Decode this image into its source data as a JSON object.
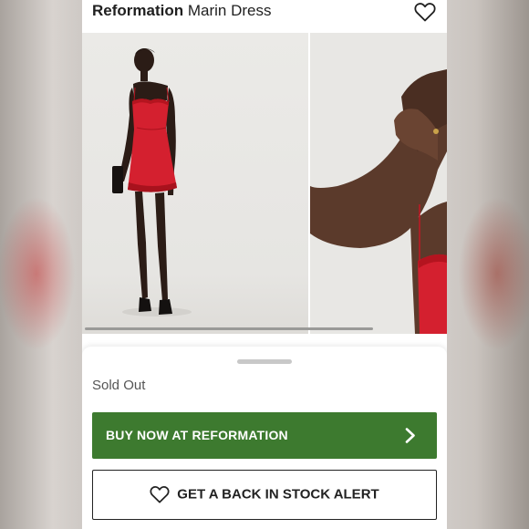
{
  "product": {
    "brand": "Reformation",
    "name": "Marin Dress"
  },
  "status": {
    "sold_out": "Sold Out"
  },
  "actions": {
    "buy_now_label": "BUY NOW AT REFORMATION",
    "back_in_stock_label": "GET A BACK IN STOCK ALERT"
  },
  "icons": {
    "favorite": "heart-outline-icon",
    "buy_arrow": "chevron-right-icon",
    "alert": "heart-outline-icon"
  },
  "colors": {
    "buy_button": "#3d7a2f",
    "dress": "#d4202f"
  }
}
